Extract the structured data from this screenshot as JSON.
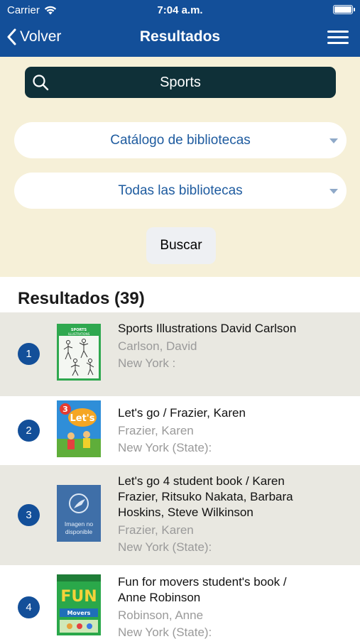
{
  "status_bar": {
    "carrier": "Carrier",
    "time": "7:04 a.m."
  },
  "nav": {
    "back_label": "Volver",
    "title": "Resultados"
  },
  "search": {
    "query": "Sports"
  },
  "filters": {
    "catalog": "Catálogo de bibliotecas",
    "libraries": "Todas las bibliotecas"
  },
  "search_button": "Buscar",
  "results": {
    "heading": "Resultados (39)",
    "items": [
      {
        "number": "1",
        "title": "Sports Illustrations David Carlson",
        "author": "Carlson, David",
        "place": "New York :"
      },
      {
        "number": "2",
        "title": "Let's go / Frazier, Karen",
        "author": "Frazier, Karen",
        "place": "New York (State):"
      },
      {
        "number": "3",
        "title": "Let's go 4 student book / Karen Frazier, Ritsuko Nakata, Barbara Hoskins, Steve Wilkinson",
        "author": "Frazier, Karen",
        "place": "New York (State):",
        "no_image_text": "Imagen no disponible"
      },
      {
        "number": "4",
        "title": "Fun for movers student's book / Anne Robinson",
        "author": "Robinson, Anne",
        "place": "New York (State):"
      }
    ]
  },
  "colors": {
    "nav": "#134f99",
    "panel": "#f6f0d8",
    "search": "#0f3038",
    "alt_row": "#e9e8e1"
  }
}
